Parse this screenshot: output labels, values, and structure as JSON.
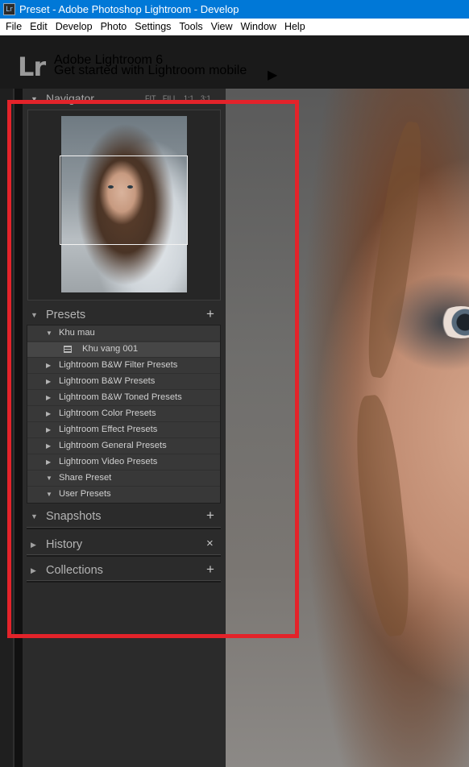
{
  "window": {
    "title": "Preset - Adobe Photoshop Lightroom - Develop",
    "icon_text": "Lr"
  },
  "menu": [
    "File",
    "Edit",
    "Develop",
    "Photo",
    "Settings",
    "Tools",
    "View",
    "Window",
    "Help"
  ],
  "identity": {
    "logo": "Lr",
    "product": "Adobe Lightroom 6",
    "mobile_prompt": "Get started with Lightroom mobile",
    "mobile_arrow": "▶"
  },
  "navigator": {
    "title": "Navigator",
    "zoom_options": "FIT FILL 1:1 3:1"
  },
  "presets": {
    "title": "Presets",
    "add_symbol": "+",
    "rows": [
      {
        "label": "Khu mau",
        "expanded": true
      },
      {
        "label": "Khu vang 001",
        "child": true
      },
      {
        "label": "Lightroom B&W Filter Presets",
        "expanded": false
      },
      {
        "label": "Lightroom B&W Presets",
        "expanded": false
      },
      {
        "label": "Lightroom B&W Toned Presets",
        "expanded": false
      },
      {
        "label": "Lightroom Color Presets",
        "expanded": false
      },
      {
        "label": "Lightroom Effect Presets",
        "expanded": false
      },
      {
        "label": "Lightroom General Presets",
        "expanded": false
      },
      {
        "label": "Lightroom Video Presets",
        "expanded": false
      },
      {
        "label": "Share Preset",
        "expanded": true
      },
      {
        "label": "User Presets",
        "expanded": true
      }
    ]
  },
  "snapshots": {
    "title": "Snapshots",
    "action": "+"
  },
  "history": {
    "title": "History",
    "action": "×"
  },
  "collections": {
    "title": "Collections",
    "action": "+"
  },
  "colors": {
    "titlebar": "#0078d7",
    "panel": "#2b2b2b",
    "highlight": "#e3232a"
  }
}
